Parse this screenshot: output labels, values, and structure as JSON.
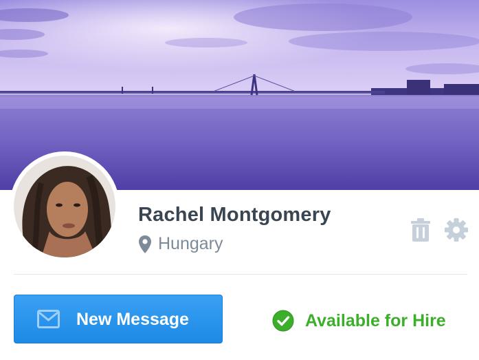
{
  "profile": {
    "name": "Rachel Montgomery",
    "location": "Hungary",
    "status": "Available for Hire"
  },
  "actions": {
    "message_label": "New Message"
  },
  "icons": {
    "location": "map-pin-icon",
    "delete": "trash-icon",
    "settings": "gear-icon",
    "message": "envelope-icon",
    "status": "check-circle-icon"
  },
  "colors": {
    "primary": "#2391ec",
    "success": "#3dae2b",
    "text_dark": "#3a4552",
    "text_muted": "#7d8b99",
    "icon_muted": "#c5d0da"
  }
}
